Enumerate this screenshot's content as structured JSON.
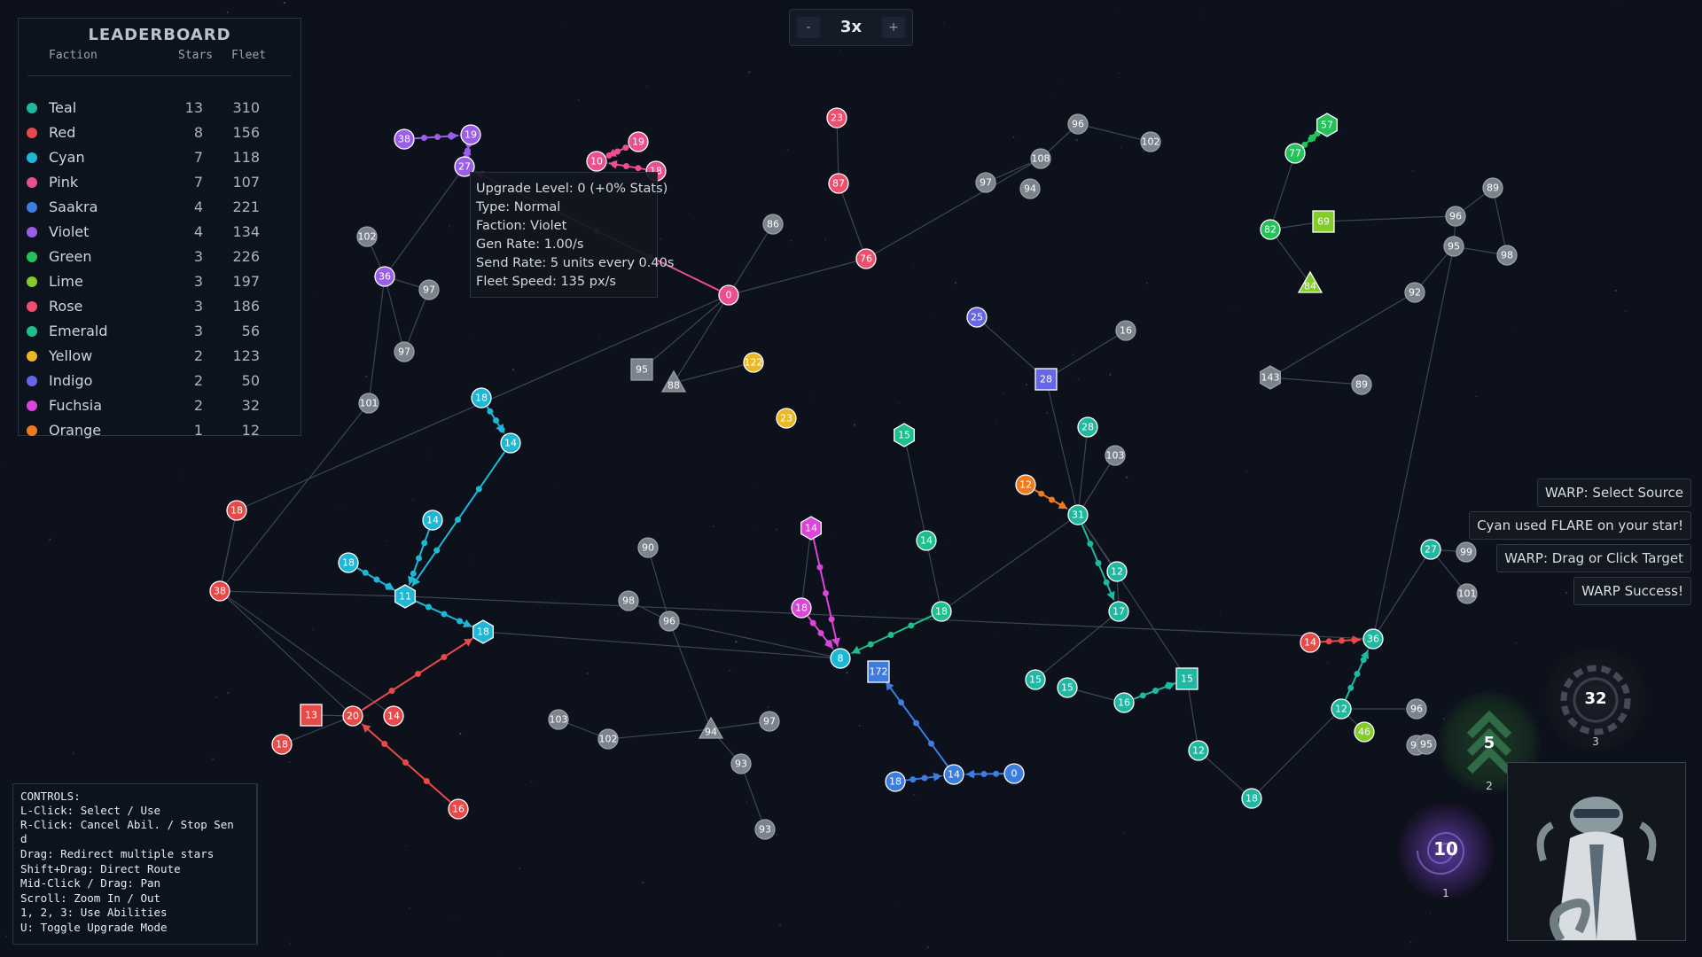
{
  "zoom": {
    "minus_label": "-",
    "level": "3x",
    "plus_label": "+"
  },
  "leaderboard": {
    "title": "LEADERBOARD",
    "col_faction": "Faction",
    "col_stars": "Stars",
    "col_fleet": "Fleet",
    "rows": [
      {
        "name": "Teal",
        "stars": "13",
        "fleet": "310",
        "color": "#20b8a0"
      },
      {
        "name": "Red",
        "stars": "8",
        "fleet": "156",
        "color": "#e84a4a"
      },
      {
        "name": "Cyan",
        "stars": "7",
        "fleet": "118",
        "color": "#1fb7d6"
      },
      {
        "name": "Pink",
        "stars": "7",
        "fleet": "107",
        "color": "#ec4f8f"
      },
      {
        "name": "Saakra",
        "stars": "4",
        "fleet": "221",
        "color": "#3e7de0"
      },
      {
        "name": "Violet",
        "stars": "4",
        "fleet": "134",
        "color": "#9a5ee8"
      },
      {
        "name": "Green",
        "stars": "3",
        "fleet": "226",
        "color": "#25c25c"
      },
      {
        "name": "Lime",
        "stars": "3",
        "fleet": "197",
        "color": "#84cc2a"
      },
      {
        "name": "Rose",
        "stars": "3",
        "fleet": "186",
        "color": "#ef4f6e"
      },
      {
        "name": "Emerald",
        "stars": "3",
        "fleet": "56",
        "color": "#1dbf8a"
      },
      {
        "name": "Yellow",
        "stars": "2",
        "fleet": "123",
        "color": "#e8b925"
      },
      {
        "name": "Indigo",
        "stars": "2",
        "fleet": "50",
        "color": "#6767e6"
      },
      {
        "name": "Fuchsia",
        "stars": "2",
        "fleet": "32",
        "color": "#d946d9"
      },
      {
        "name": "Orange",
        "stars": "1",
        "fleet": "12",
        "color": "#f07a1e"
      }
    ]
  },
  "tooltip": {
    "lines": [
      "Upgrade Level: 0 (+0% Stats)",
      "Type: Normal",
      "Faction: Violet",
      "Gen Rate: 1.00/s",
      "Send Rate: 5 units every 0.40s",
      "Fleet Speed: 135 px/s"
    ]
  },
  "controls": {
    "lines": [
      "CONTROLS:",
      "L-Click: Select / Use",
      "R-Click: Cancel Abil. / Stop Sen",
      "d",
      "Drag: Redirect multiple stars",
      "Shift+Drag: Direct Route",
      "Mid-Click / Drag: Pan",
      "Scroll: Zoom In / Out",
      "1, 2, 3: Use Abilities",
      "U: Toggle Upgrade Mode"
    ]
  },
  "messages": [
    "WARP: Select Source",
    "Cyan used FLARE on your star!",
    "WARP: Drag or Click Target",
    "WARP Success!"
  ],
  "abilities": [
    {
      "name": "warp",
      "count": "10",
      "key": "1",
      "icon": "vortex-icon"
    },
    {
      "name": "boost",
      "count": "5",
      "key": "2",
      "icon": "chevron-up-icon"
    },
    {
      "name": "shield",
      "count": "32",
      "key": "3",
      "icon": "gear-icon"
    }
  ],
  "colors": {
    "neutral": "#7d838c",
    "teal": "#20b8a0",
    "red": "#e84a4a",
    "cyan": "#1fb7d6",
    "pink": "#ec4f8f",
    "saakra": "#3e7de0",
    "violet": "#9a5ee8",
    "green": "#25c25c",
    "lime": "#84cc2a",
    "yellow": "#e8b925",
    "indigo": "#6767e6",
    "fuchsia": "#d946d9",
    "orange": "#f07a1e"
  },
  "stars": [
    {
      "id": "s1",
      "owner": "violet",
      "units": "38",
      "shape": "circle"
    },
    {
      "id": "s2",
      "owner": "violet",
      "units": "19",
      "shape": "circle"
    },
    {
      "id": "s3",
      "owner": "violet",
      "units": "27",
      "shape": "circle"
    },
    {
      "id": "s4",
      "owner": "pink",
      "units": "10",
      "shape": "circle"
    },
    {
      "id": "s5",
      "owner": "pink",
      "units": "19",
      "shape": "circle"
    },
    {
      "id": "s6",
      "owner": "pink",
      "units": "18",
      "shape": "circle"
    },
    {
      "id": "s7",
      "owner": "rose",
      "units": "23",
      "shape": "circle"
    },
    {
      "id": "s8",
      "owner": "rose",
      "units": "87",
      "shape": "circle"
    },
    {
      "id": "s9",
      "owner": "rose",
      "units": "76",
      "shape": "circle"
    },
    {
      "id": "s10",
      "owner": "pink",
      "units": "0",
      "shape": "circle"
    },
    {
      "id": "s11",
      "owner": "neutral",
      "units": "96",
      "shape": "circle"
    },
    {
      "id": "s12",
      "owner": "neutral",
      "units": "102",
      "shape": "circle"
    },
    {
      "id": "s13",
      "owner": "neutral",
      "units": "108",
      "shape": "circle"
    },
    {
      "id": "s14",
      "owner": "neutral",
      "units": "97",
      "shape": "circle"
    },
    {
      "id": "s15",
      "owner": "neutral",
      "units": "94",
      "shape": "circle"
    },
    {
      "id": "s16",
      "owner": "neutral",
      "units": "86",
      "shape": "circle"
    },
    {
      "id": "s17",
      "owner": "neutral",
      "units": "102",
      "shape": "circle"
    },
    {
      "id": "s18",
      "owner": "violet",
      "units": "36",
      "shape": "circle"
    },
    {
      "id": "s19",
      "owner": "neutral",
      "units": "97",
      "shape": "circle"
    },
    {
      "id": "s20",
      "owner": "neutral",
      "units": "97",
      "shape": "circle"
    },
    {
      "id": "s21",
      "owner": "neutral",
      "units": "101",
      "shape": "circle"
    },
    {
      "id": "s22",
      "owner": "neutral",
      "units": "95",
      "shape": "square"
    },
    {
      "id": "s23",
      "owner": "neutral",
      "units": "88",
      "shape": "triangle"
    },
    {
      "id": "s24",
      "owner": "yellow",
      "units": "122",
      "shape": "circle"
    },
    {
      "id": "s25",
      "owner": "yellow",
      "units": "23",
      "shape": "circle"
    },
    {
      "id": "s26",
      "owner": "green",
      "units": "57",
      "shape": "hexagon"
    },
    {
      "id": "s27",
      "owner": "green",
      "units": "77",
      "shape": "circle"
    },
    {
      "id": "s28",
      "owner": "green",
      "units": "82",
      "shape": "circle"
    },
    {
      "id": "s29",
      "owner": "lime",
      "units": "69",
      "shape": "square"
    },
    {
      "id": "s30",
      "owner": "lime",
      "units": "84",
      "shape": "triangle"
    },
    {
      "id": "s31",
      "owner": "neutral",
      "units": "89",
      "shape": "circle"
    },
    {
      "id": "s32",
      "owner": "neutral",
      "units": "96",
      "shape": "circle"
    },
    {
      "id": "s33",
      "owner": "neutral",
      "units": "95",
      "shape": "circle"
    },
    {
      "id": "s34",
      "owner": "neutral",
      "units": "98",
      "shape": "circle"
    },
    {
      "id": "s35",
      "owner": "neutral",
      "units": "92",
      "shape": "circle"
    },
    {
      "id": "s36",
      "owner": "neutral",
      "units": "143",
      "shape": "hexagon"
    },
    {
      "id": "s37",
      "owner": "neutral",
      "units": "89",
      "shape": "circle"
    },
    {
      "id": "s38",
      "owner": "indigo",
      "units": "25",
      "shape": "circle"
    },
    {
      "id": "s39",
      "owner": "neutral",
      "units": "16",
      "shape": "circle"
    },
    {
      "id": "s40",
      "owner": "indigo",
      "units": "28",
      "shape": "square"
    },
    {
      "id": "s41",
      "owner": "teal",
      "units": "28",
      "shape": "circle"
    },
    {
      "id": "s42",
      "owner": "neutral",
      "units": "103",
      "shape": "circle"
    },
    {
      "id": "s43",
      "owner": "orange",
      "units": "12",
      "shape": "circle"
    },
    {
      "id": "s44",
      "owner": "teal",
      "units": "31",
      "shape": "circle"
    },
    {
      "id": "s45",
      "owner": "teal",
      "units": "12",
      "shape": "circle"
    },
    {
      "id": "s46",
      "owner": "teal",
      "units": "17",
      "shape": "circle"
    },
    {
      "id": "s47",
      "owner": "emerald",
      "units": "15",
      "shape": "hexagon"
    },
    {
      "id": "s48",
      "owner": "emerald",
      "units": "14",
      "shape": "circle"
    },
    {
      "id": "s49",
      "owner": "emerald",
      "units": "18",
      "shape": "circle"
    },
    {
      "id": "s50",
      "owner": "cyan",
      "units": "18",
      "shape": "circle"
    },
    {
      "id": "s51",
      "owner": "cyan",
      "units": "14",
      "shape": "circle"
    },
    {
      "id": "s52",
      "owner": "cyan",
      "units": "14",
      "shape": "circle"
    },
    {
      "id": "s53",
      "owner": "cyan",
      "units": "18",
      "shape": "circle"
    },
    {
      "id": "s54",
      "owner": "cyan",
      "units": "11",
      "shape": "hexagon"
    },
    {
      "id": "s55",
      "owner": "cyan",
      "units": "18",
      "shape": "hexagon"
    },
    {
      "id": "s56",
      "owner": "red",
      "units": "18",
      "shape": "circle"
    },
    {
      "id": "s57",
      "owner": "red",
      "units": "38",
      "shape": "circle"
    },
    {
      "id": "s58",
      "owner": "red",
      "units": "13",
      "shape": "square"
    },
    {
      "id": "s59",
      "owner": "red",
      "units": "20",
      "shape": "circle"
    },
    {
      "id": "s60",
      "owner": "red",
      "units": "14",
      "shape": "circle"
    },
    {
      "id": "s61",
      "owner": "red",
      "units": "18",
      "shape": "circle"
    },
    {
      "id": "s62",
      "owner": "red",
      "units": "16",
      "shape": "circle"
    },
    {
      "id": "s63",
      "owner": "neutral",
      "units": "90",
      "shape": "circle"
    },
    {
      "id": "s64",
      "owner": "neutral",
      "units": "98",
      "shape": "circle"
    },
    {
      "id": "s65",
      "owner": "neutral",
      "units": "96",
      "shape": "circle"
    },
    {
      "id": "s66",
      "owner": "fuchsia",
      "units": "14",
      "shape": "hexagon"
    },
    {
      "id": "s67",
      "owner": "fuchsia",
      "units": "18",
      "shape": "circle"
    },
    {
      "id": "s68",
      "owner": "cyan",
      "units": "8",
      "shape": "circle"
    },
    {
      "id": "s69",
      "owner": "saakra",
      "units": "172",
      "shape": "square"
    },
    {
      "id": "s70",
      "owner": "saakra",
      "units": "18",
      "shape": "circle"
    },
    {
      "id": "s71",
      "owner": "saakra",
      "units": "14",
      "shape": "circle"
    },
    {
      "id": "s72",
      "owner": "saakra",
      "units": "0",
      "shape": "circle"
    },
    {
      "id": "s73",
      "owner": "neutral",
      "units": "103",
      "shape": "circle"
    },
    {
      "id": "s74",
      "owner": "neutral",
      "units": "102",
      "shape": "circle"
    },
    {
      "id": "s75",
      "owner": "neutral",
      "units": "94",
      "shape": "triangle"
    },
    {
      "id": "s76",
      "owner": "neutral",
      "units": "97",
      "shape": "circle"
    },
    {
      "id": "s77",
      "owner": "neutral",
      "units": "93",
      "shape": "circle"
    },
    {
      "id": "s78",
      "owner": "neutral",
      "units": "93",
      "shape": "circle"
    },
    {
      "id": "s79",
      "owner": "teal",
      "units": "15",
      "shape": "circle"
    },
    {
      "id": "s80",
      "owner": "teal",
      "units": "15",
      "shape": "circle"
    },
    {
      "id": "s81",
      "owner": "teal",
      "units": "16",
      "shape": "circle"
    },
    {
      "id": "s82",
      "owner": "teal",
      "units": "15",
      "shape": "square"
    },
    {
      "id": "s83",
      "owner": "teal",
      "units": "12",
      "shape": "circle"
    },
    {
      "id": "s84",
      "owner": "teal",
      "units": "18",
      "shape": "circle"
    },
    {
      "id": "s85",
      "owner": "red",
      "units": "14",
      "shape": "circle"
    },
    {
      "id": "s86",
      "owner": "teal",
      "units": "36",
      "shape": "circle"
    },
    {
      "id": "s87",
      "owner": "teal",
      "units": "12",
      "shape": "circle"
    },
    {
      "id": "s88",
      "owner": "lime",
      "units": "46",
      "shape": "circle"
    },
    {
      "id": "s89",
      "owner": "teal",
      "units": "27",
      "shape": "circle"
    },
    {
      "id": "s90",
      "owner": "neutral",
      "units": "99",
      "shape": "circle"
    },
    {
      "id": "s91",
      "owner": "neutral",
      "units": "101",
      "shape": "circle"
    },
    {
      "id": "s92",
      "owner": "neutral",
      "units": "99",
      "shape": "circle"
    },
    {
      "id": "s93",
      "owner": "neutral",
      "units": "96",
      "shape": "circle"
    },
    {
      "id": "s94",
      "owner": "neutral",
      "units": "95",
      "shape": "circle"
    }
  ]
}
